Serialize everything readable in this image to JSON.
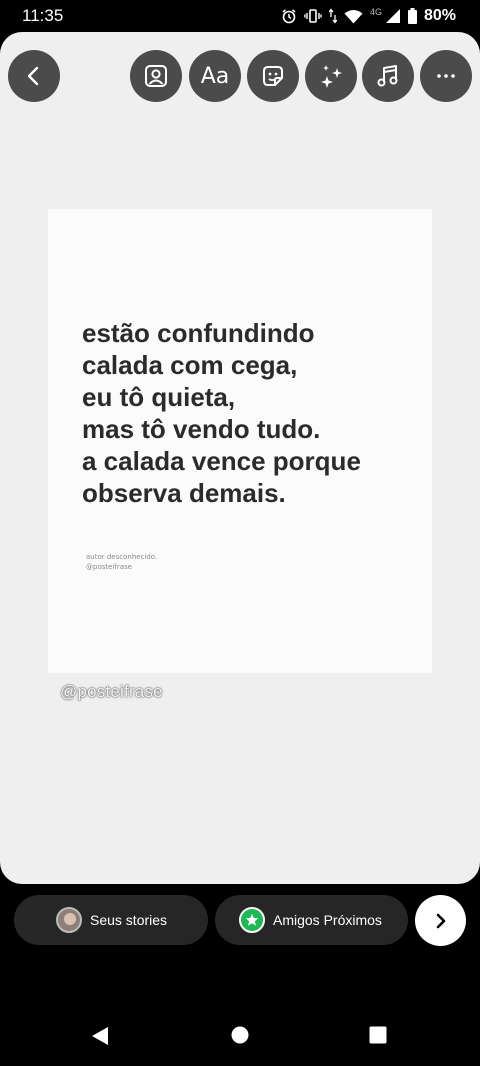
{
  "status_bar": {
    "time": "11:35",
    "network": "4G",
    "battery": "80%"
  },
  "toolbar": {
    "back_icon": "chevron-left-icon",
    "text_tool_label": "Aa",
    "more_label": "···",
    "icons": [
      "mention-person-icon",
      "sticker-icon",
      "effects-sparkle-icon",
      "music-note-icon"
    ]
  },
  "post": {
    "quote_lines": [
      "estão confundindo",
      "calada com cega,",
      "eu tô quieta,",
      "mas tô vendo tudo.",
      "a calada vence porque",
      "observa demais."
    ],
    "credit_author": "autor desconhecido.",
    "credit_handle": "@posteifrase"
  },
  "mention_sticker": "@posteifrase",
  "share": {
    "your_story_label": "Seus stories",
    "close_friends_label": "Amigos Próximos",
    "close_friends_color": "#1db954"
  },
  "nav": {
    "icons": [
      "back-triangle-icon",
      "home-circle-icon",
      "recents-square-icon"
    ]
  }
}
